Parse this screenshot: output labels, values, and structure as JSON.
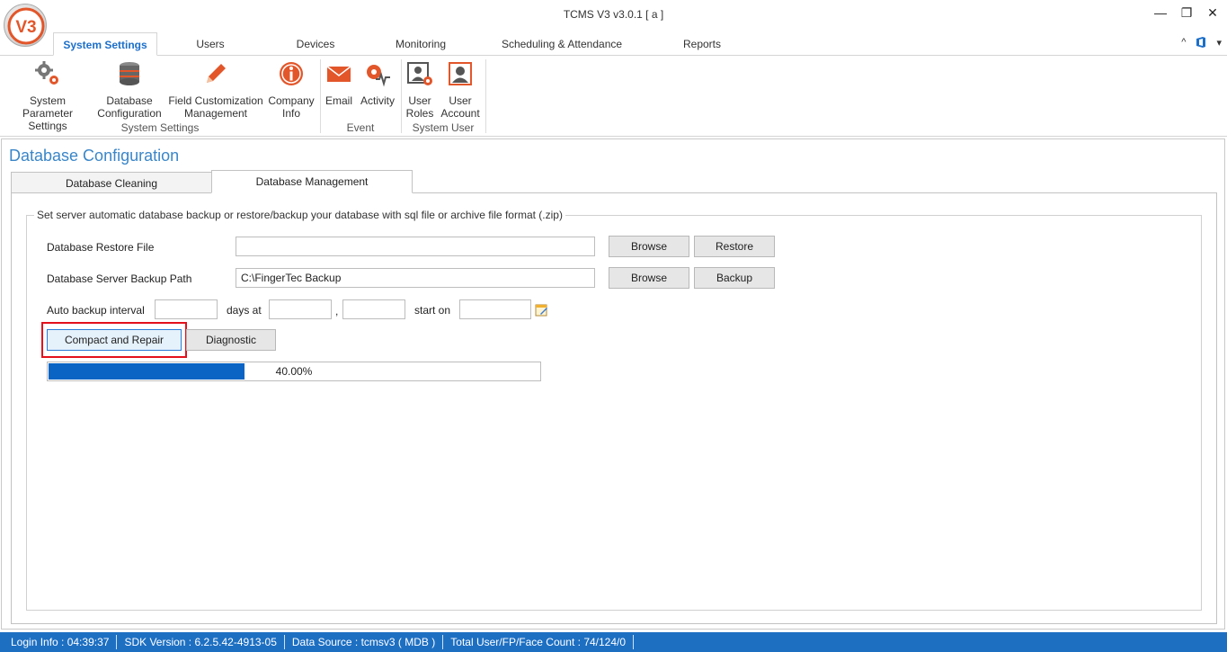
{
  "window": {
    "title": "TCMS V3 v3.0.1 [ a ]",
    "logo_text": "V3",
    "minimize_glyph": "—",
    "restore_glyph": "❐",
    "close_glyph": "✕"
  },
  "ribbon_tabs": [
    {
      "label": "System Settings",
      "active": true
    },
    {
      "label": "Users",
      "active": false
    },
    {
      "label": "Devices",
      "active": false
    },
    {
      "label": "Monitoring",
      "active": false
    },
    {
      "label": "Scheduling & Attendance",
      "active": false
    },
    {
      "label": "Reports",
      "active": false
    }
  ],
  "ribbon_right": {
    "collapse_glyph": "^",
    "office_icon": "office-icon",
    "dropdown_glyph": "▾"
  },
  "ribbon_buttons": [
    {
      "line1": "System Parameter",
      "line2": "Settings",
      "icon": "gears-icon"
    },
    {
      "line1": "Database",
      "line2": "Configuration",
      "icon": "database-icon"
    },
    {
      "line1": "Field Customization",
      "line2": "Management",
      "icon": "pencil-icon"
    },
    {
      "line1": "Company",
      "line2": "Info",
      "icon": "info-icon"
    },
    {
      "line1": "Email",
      "line2": "",
      "icon": "email-icon"
    },
    {
      "line1": "Activity",
      "line2": "",
      "icon": "activity-icon"
    },
    {
      "line1": "User",
      "line2": "Roles",
      "icon": "user-roles-icon"
    },
    {
      "line1": "User",
      "line2": "Account",
      "icon": "user-account-icon"
    }
  ],
  "ribbon_groups": [
    "System Settings",
    "Event",
    "System User"
  ],
  "page": {
    "title": "Database Configuration",
    "tabs": [
      {
        "label": "Database Cleaning",
        "active": false
      },
      {
        "label": "Database Management",
        "active": true
      }
    ],
    "group_caption": "Set server automatic database backup or restore/backup your database with sql file or archive file format (.zip)",
    "restore_label": "Database Restore File",
    "restore_value": "",
    "backup_path_label": "Database Server Backup Path",
    "backup_path_value": "C:\\FingerTec Backup",
    "browse_label": "Browse",
    "restore_button": "Restore",
    "backup_button": "Backup",
    "auto_backup_label": "Auto backup interval",
    "days_at_label": "days at",
    "comma": ",",
    "start_on_label": "start on",
    "interval_value": "",
    "hour_value": "",
    "minute_value": "",
    "start_date_value": "",
    "compact_button": "Compact and Repair",
    "diagnostic_button": "Diagnostic",
    "progress": {
      "percent": 40,
      "text": "40.00%"
    }
  },
  "status": {
    "login_info": "Login Info : 04:39:37",
    "sdk_version": "SDK Version : 6.2.5.42-4913-05",
    "data_source": "Data Source : tcmsv3 ( MDB )",
    "counts": "Total User/FP/Face Count : 74/124/0"
  },
  "colors": {
    "accent": "#1c6fc9",
    "status_bar": "#1d6fc2",
    "progress": "#0a64c4",
    "highlight": "#e3101c",
    "icon_orange": "#e2562a"
  }
}
